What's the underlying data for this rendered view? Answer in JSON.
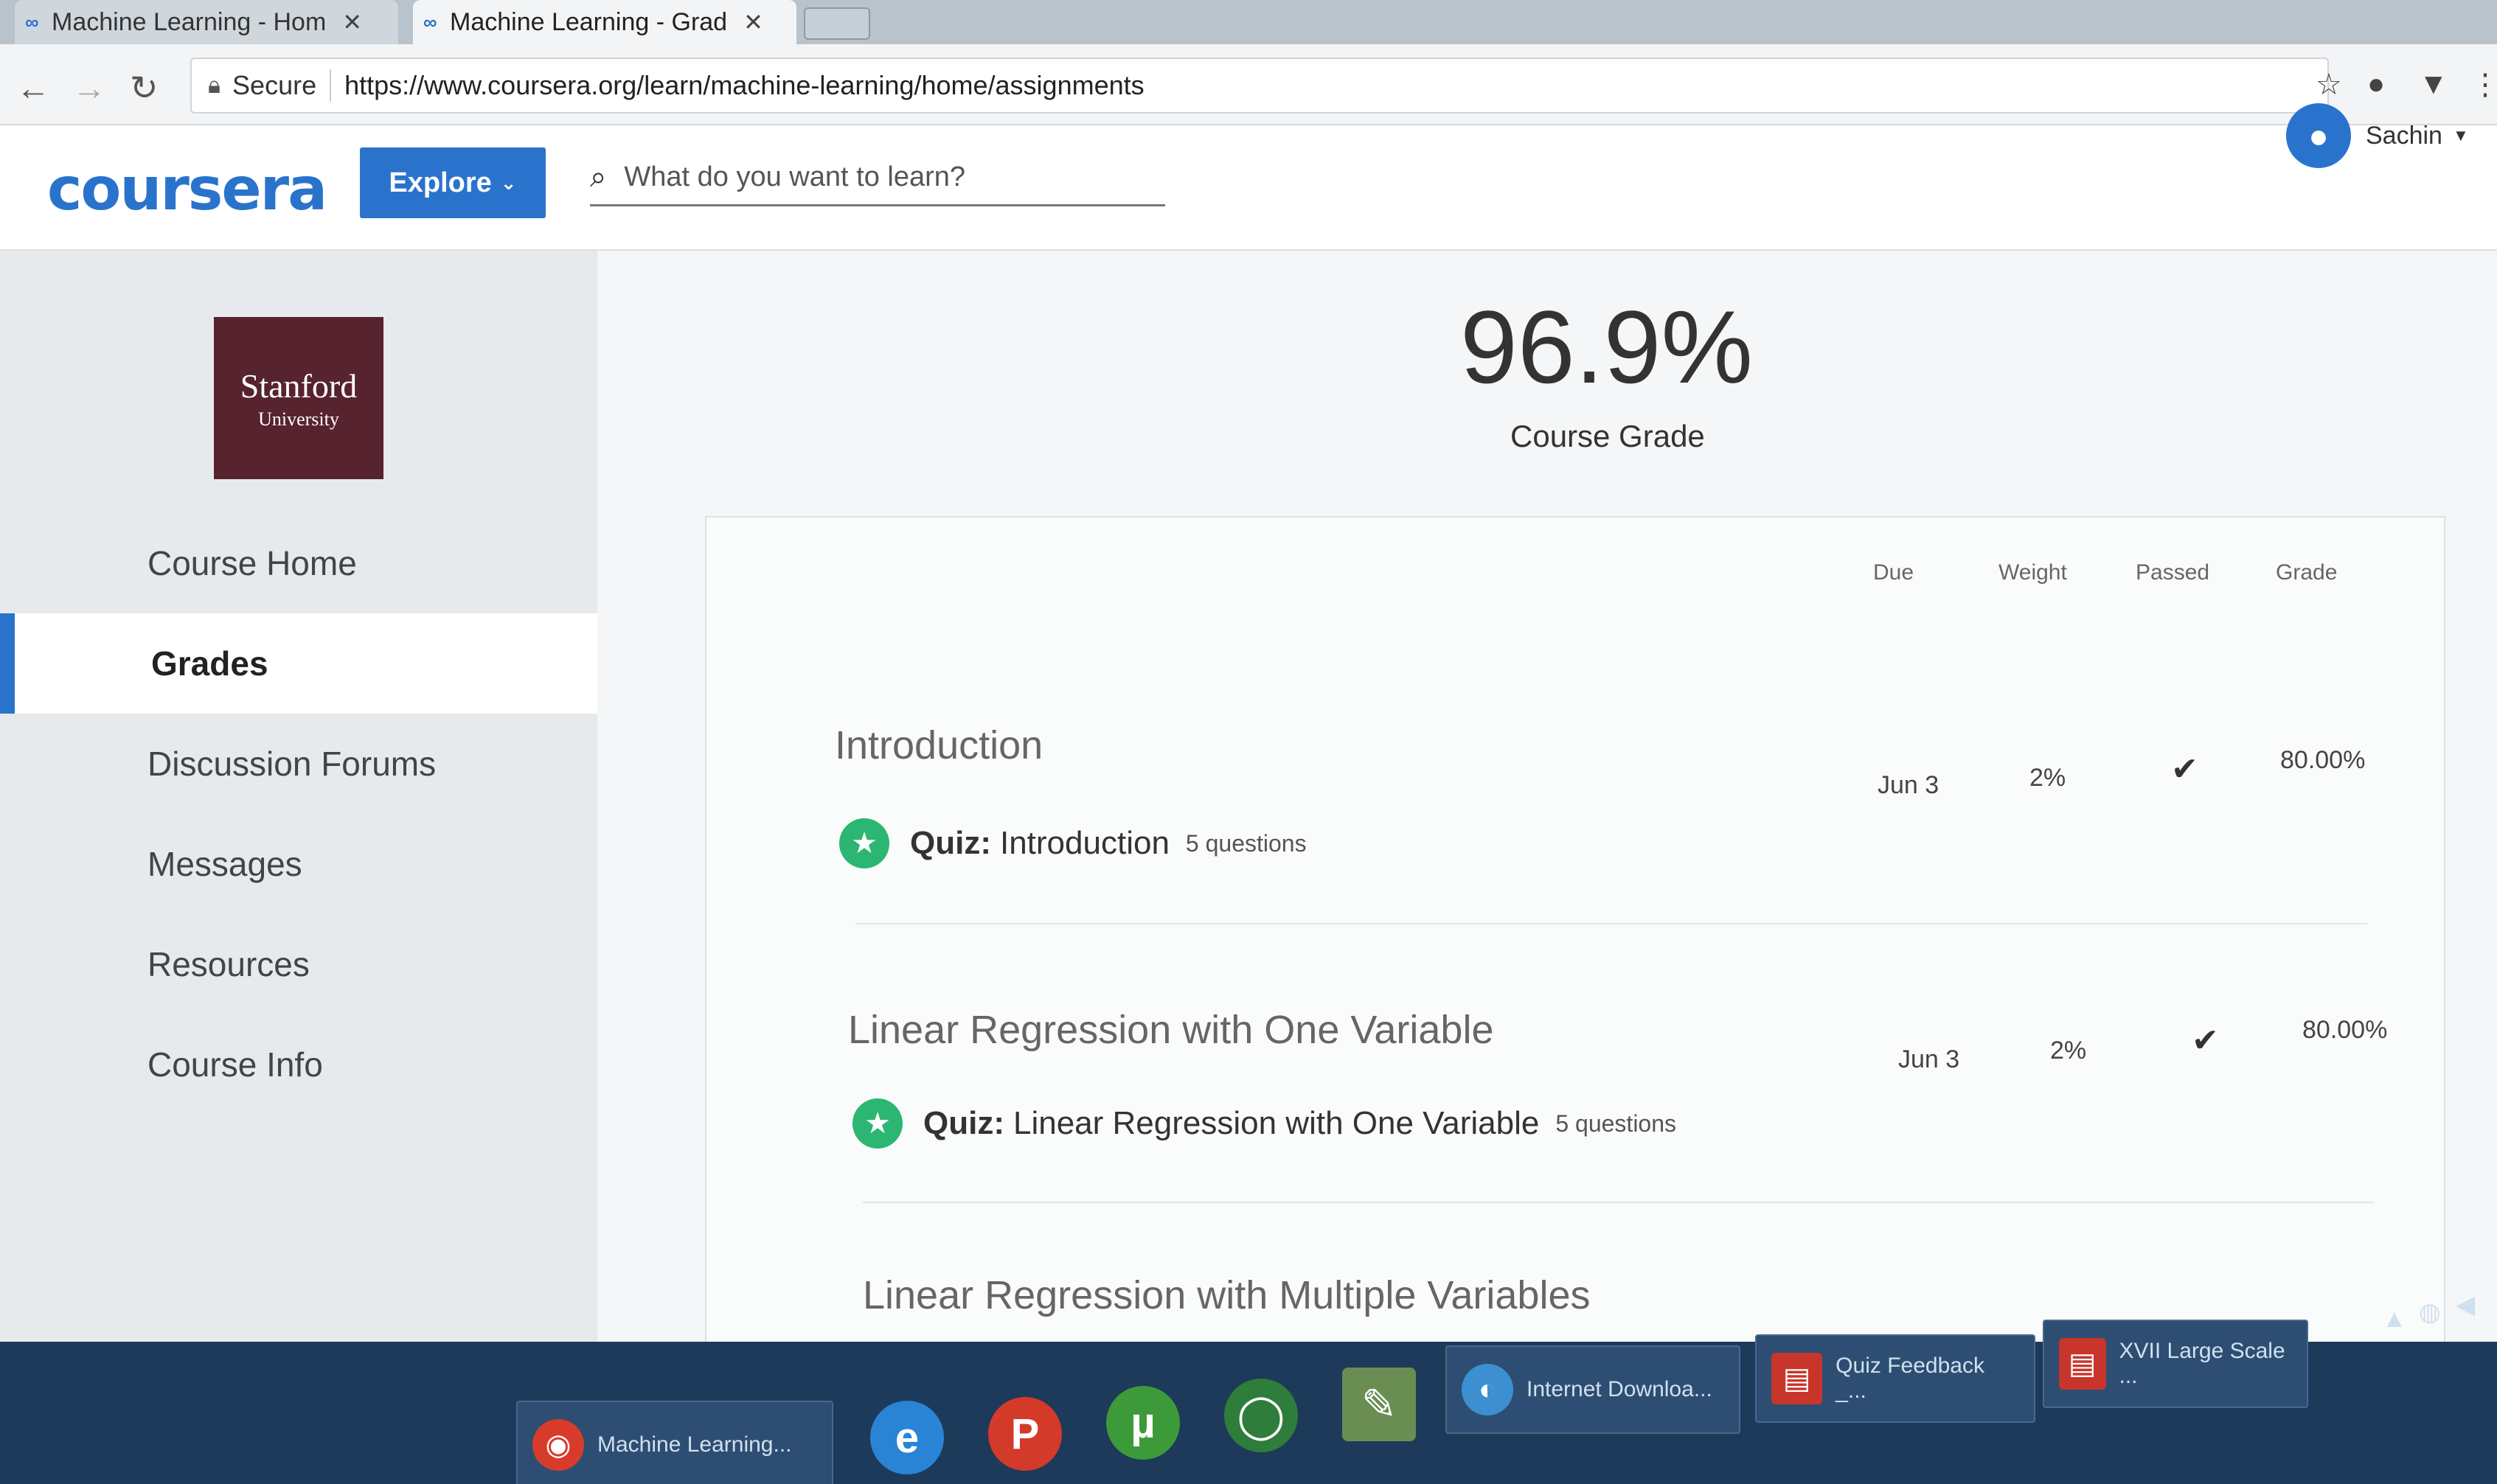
{
  "browser": {
    "tabs": [
      {
        "label": "Machine Learning - Hom",
        "active": false
      },
      {
        "label": "Machine Learning - Grad",
        "active": true
      }
    ],
    "secure_label": "Secure",
    "url": "https://www.coursera.org/learn/machine-learning/home/assignments"
  },
  "header": {
    "logo": "coursera",
    "explore_label": "Explore",
    "search_placeholder": "What do you want to learn?",
    "user_name": "Sachin"
  },
  "sidebar": {
    "university_name": "Stanford",
    "university_sub": "University",
    "items": [
      {
        "label": "Course Home",
        "active": false
      },
      {
        "label": "Grades",
        "active": true
      },
      {
        "label": "Discussion Forums",
        "active": false
      },
      {
        "label": "Messages",
        "active": false
      },
      {
        "label": "Resources",
        "active": false
      },
      {
        "label": "Course Info",
        "active": false
      }
    ]
  },
  "grades": {
    "course_grade": "96.9%",
    "course_grade_label": "Course Grade",
    "columns": [
      "Due",
      "Weight",
      "Passed",
      "Grade"
    ],
    "sections": [
      {
        "title": "Introduction",
        "quiz_type": "Quiz:",
        "quiz_name": "Introduction",
        "questions": "5 questions",
        "due": "Jun 3",
        "weight": "2%",
        "passed": true,
        "grade": "80.00%"
      },
      {
        "title": "Linear Regression with One Variable",
        "quiz_type": "Quiz:",
        "quiz_name": "Linear Regression with One Variable",
        "questions": "5 questions",
        "due": "Jun 3",
        "weight": "2%",
        "passed": true,
        "grade": "80.00%"
      },
      {
        "title": "Linear Regression with Multiple Variables"
      }
    ]
  },
  "taskbar": {
    "buttons": [
      {
        "label": "Machine Learning..."
      },
      {
        "label": "Internet Downloa..."
      },
      {
        "label": "Quiz Feedback _..."
      },
      {
        "label": "XVII Large Scale ..."
      }
    ],
    "pinned": [
      {
        "icon": "internet-explorer-icon",
        "glyph": "e"
      },
      {
        "icon": "p-app-icon",
        "glyph": "P"
      },
      {
        "icon": "utorrent-icon",
        "glyph": "µ"
      },
      {
        "icon": "green-ring-icon",
        "glyph": "◯"
      },
      {
        "icon": "notepad-icon",
        "glyph": "✎"
      }
    ]
  },
  "colors": {
    "accent": "#2a73cc",
    "passed": "#2bb673",
    "stanford": "#56232e"
  }
}
